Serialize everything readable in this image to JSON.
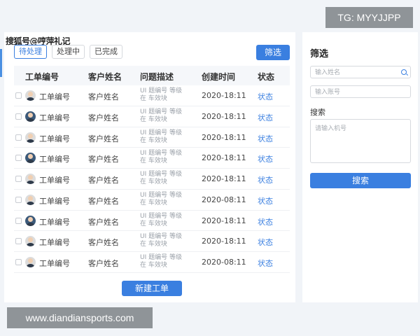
{
  "watermarks": {
    "top_right": "TG: MYYJJPP",
    "bottom_left": "www.diandiansports.com",
    "corner_text": "搜狐号@哼萍礼记"
  },
  "tabs": [
    {
      "label": "待处理",
      "active": true
    },
    {
      "label": "处理中",
      "active": false
    },
    {
      "label": "已完成",
      "active": false
    }
  ],
  "filter_button": "筛选",
  "table": {
    "headers": [
      "工单编号",
      "客户姓名",
      "问题描述",
      "创建时间",
      "状态"
    ],
    "rows": [
      {
        "id": "工单编号",
        "name": "客户姓名",
        "desc": "UI 题编号 等级 在 车效块",
        "time": "2020-18:11",
        "status": "状态",
        "avatar": "light"
      },
      {
        "id": "工单编号",
        "name": "客户姓名",
        "desc": "UI 题编号 等级 在 车效块",
        "time": "2020-18:11",
        "status": "状态",
        "avatar": "dark"
      },
      {
        "id": "工单编号",
        "name": "客户姓名",
        "desc": "UI 题编号 等级 在 车效块",
        "time": "2020-18:11",
        "status": "状态",
        "avatar": "light"
      },
      {
        "id": "工单编号",
        "name": "客户姓名",
        "desc": "UI 题编号 等级 在 车效块",
        "time": "2020-18:11",
        "status": "状态",
        "avatar": "dark"
      },
      {
        "id": "工单编号",
        "name": "客户姓名",
        "desc": "UI 题编号 等级 在 车效块",
        "time": "2020-18:11",
        "status": "状态",
        "avatar": "light"
      },
      {
        "id": "工单编号",
        "name": "客户姓名",
        "desc": "UI 题编号 等级 在 车效块",
        "time": "2020-08:11",
        "status": "状态",
        "avatar": "light"
      },
      {
        "id": "工单编号",
        "name": "客户姓名",
        "desc": "UI 题编号 等级 在 车效块",
        "time": "2020-18:11",
        "status": "状态",
        "avatar": "dark"
      },
      {
        "id": "工单编号",
        "name": "客户姓名",
        "desc": "UI 题编号 等级 在 车效块",
        "time": "2020-18:11",
        "status": "状态",
        "avatar": "light"
      },
      {
        "id": "工单编号",
        "name": "客户姓名",
        "desc": "UI 题编号 等级 在 车效块",
        "time": "2020-08:11",
        "status": "状态",
        "avatar": "light"
      }
    ]
  },
  "new_ticket_button": "新建工单",
  "right_panel": {
    "title": "筛选",
    "name_placeholder": "输入姓名",
    "account_placeholder": "输入账号",
    "search_label": "搜索",
    "phone_placeholder": "请输入机号",
    "search_button": "搜索"
  },
  "colors": {
    "accent": "#3a7fe0",
    "badge_bg": "#8f9498",
    "page_bg": "#f1f4f8"
  },
  "icons": [
    "search-icon",
    "checkbox-icon",
    "avatar"
  ]
}
